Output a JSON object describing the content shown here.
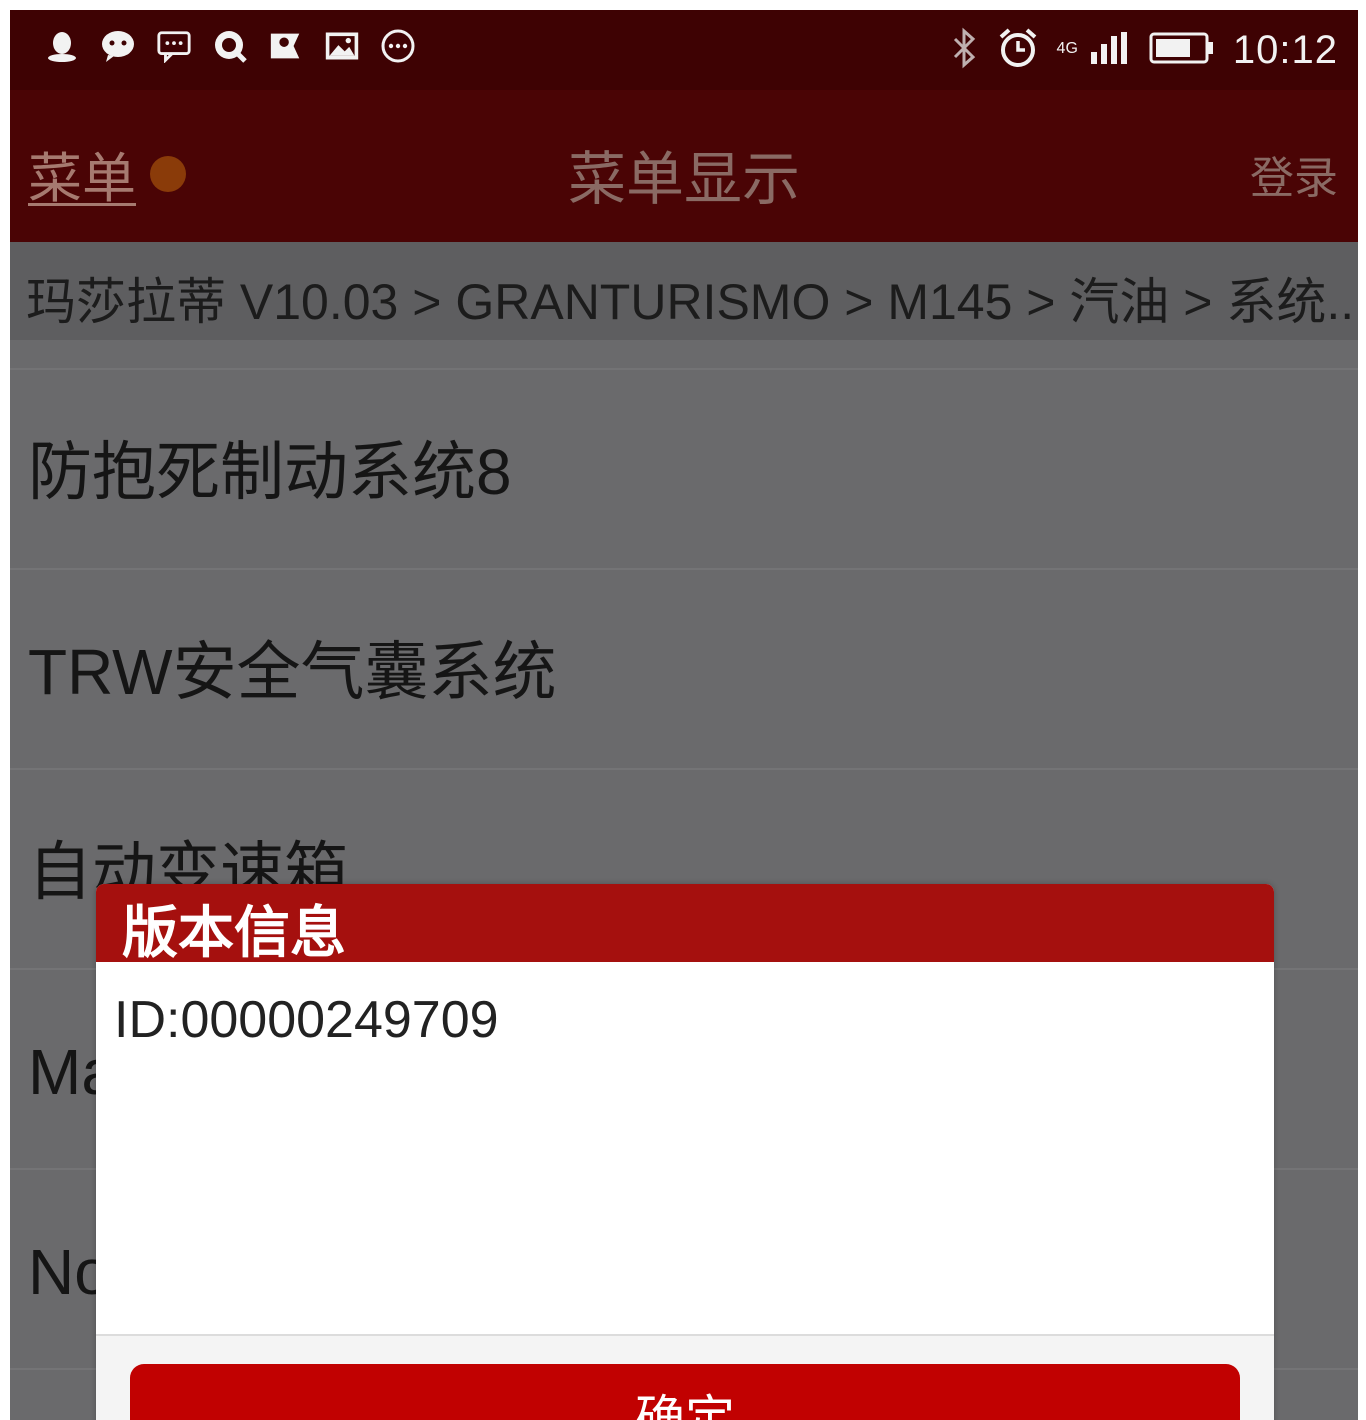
{
  "status_bar": {
    "left_icons": [
      "qq-penguin-icon",
      "wechat-icon",
      "message-icon",
      "qq-chat-icon",
      "map-pin-icon",
      "gallery-icon",
      "more-icon"
    ],
    "right_icons": [
      "bluetooth-icon",
      "alarm-icon",
      "signal-icon",
      "battery-icon"
    ],
    "network": "4G",
    "time": "10:12"
  },
  "header": {
    "menu_label": "菜单",
    "title": "菜单显示",
    "login_label": "登录"
  },
  "breadcrumb": {
    "path": "玛莎拉蒂 V10.03 > GRANTURISMO > M145 > 汽油 > 系统..."
  },
  "list": {
    "items": [
      {
        "label": "防抱死制动系统8"
      },
      {
        "label": "TRW安全气囊系统"
      },
      {
        "label": "自动变速箱"
      },
      {
        "label": "Ma"
      },
      {
        "label": "No"
      }
    ]
  },
  "dialog": {
    "title": "版本信息",
    "body": "ID:00000249709",
    "confirm_label": "确定"
  },
  "colors": {
    "status_bar": "#3e0203",
    "header": "#4a0405",
    "dialog_header": "#a5100e",
    "confirm_button": "#c10101",
    "overlay_list": "#6a6a6c"
  }
}
